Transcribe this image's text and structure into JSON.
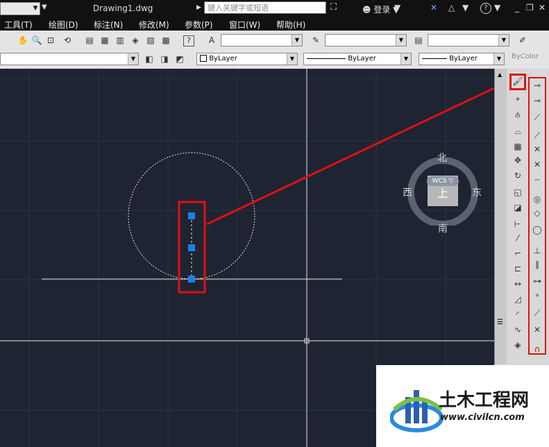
{
  "titlebar": {
    "document_title": "Drawing1.dwg",
    "search_placeholder": "键入关键字或短语",
    "login_label": "登录",
    "help_icon": "?"
  },
  "menu": {
    "items": [
      "工具(T)",
      "绘图(D)",
      "标注(N)",
      "修改(M)",
      "参数(P)",
      "窗口(W)",
      "帮助(H)"
    ]
  },
  "properties_toolbar": {
    "color_value": "ByLayer",
    "linetype_value": "ByLayer",
    "lineweight_value": "ByLayer",
    "plotstyle_value": "ByColor"
  },
  "viewcube": {
    "north": "北",
    "south": "南",
    "east": "东",
    "west": "西",
    "top": "上",
    "wcs_label": "WCS"
  },
  "watermark": {
    "title": "土木工程网",
    "url": "www.civilcn.com"
  },
  "colors": {
    "canvas_bg": "#1e2432",
    "highlight_red": "#e01010",
    "grip_blue": "#1f7fe8"
  }
}
